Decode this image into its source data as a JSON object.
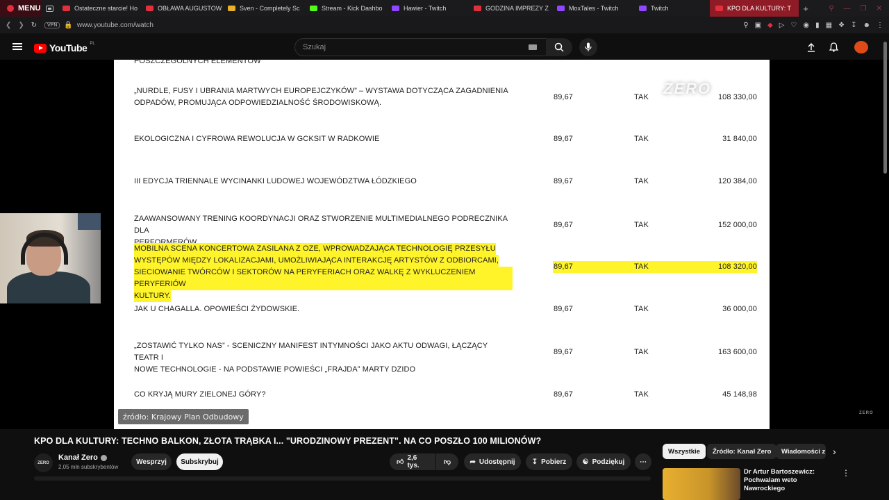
{
  "browser": {
    "menu_label": "MENU",
    "tabs": [
      {
        "label": "Ostateczne starcie! Ho",
        "icon": "youtube-icon",
        "color": "#e1303c"
      },
      {
        "label": "OBŁAWA AUGUSTOWS",
        "icon": "youtube-icon",
        "color": "#e1303c"
      },
      {
        "label": "Sven - Completely Sc",
        "icon": "crown-icon",
        "color": "#e8b12a"
      },
      {
        "label": "Stream - Kick Dashbo",
        "icon": "kick-icon",
        "color": "#53fc18"
      },
      {
        "label": "Hawier - Twitch",
        "icon": "twitch-icon",
        "color": "#9147ff"
      },
      {
        "label": "GODZINA IMPREZY Z ",
        "icon": "youtube-icon",
        "color": "#e1303c"
      },
      {
        "label": "MoxTales - Twitch",
        "icon": "twitch-muted-icon",
        "color": "#9147ff"
      },
      {
        "label": "Twitch",
        "icon": "twitch-icon",
        "color": "#9147ff"
      },
      {
        "label": "KPO DLA KULTURY: T",
        "icon": "youtube-icon",
        "color": "#e1303c",
        "active": true
      }
    ],
    "vpn_label": "VPN",
    "url": "www.youtube.com/watch"
  },
  "youtube": {
    "logo_text": "YouTube",
    "region": "PL",
    "search_placeholder": "Szukaj"
  },
  "document": {
    "top_fragment": "POSZCZEGÓLNYCH ELEMENTÓW",
    "rows": [
      {
        "title_lines": [
          "„NURDLE, FUSY I UBRANIA MARTWYCH EUROPEJCZYKÓW” – WYSTAWA DOTYCZĄCA ZAGADNIENIA",
          "ODPADÓW, PROMUJĄCA ODPOWIEDZIALNOŚĆ ŚRODOWISKOWĄ."
        ],
        "score": "89,67",
        "ok": "TAK",
        "amount": "108 330,00"
      },
      {
        "title_lines": [
          "EKOLOGICZNA I CYFROWA REWOLUCJA W GCKSIT W RADKOWIE"
        ],
        "score": "89,67",
        "ok": "TAK",
        "amount": "31 840,00"
      },
      {
        "title_lines": [
          "III EDYCJA TRIENNALE WYCINANKI LUDOWEJ WOJEWÓDZTWA ŁÓDZKIEGO"
        ],
        "score": "89,67",
        "ok": "TAK",
        "amount": "120 384,00"
      },
      {
        "title_lines": [
          "ZAAWANSOWANY TRENING KOORDYNACJI ORAZ  STWORZENIE MULTIMEDIALNEGO PODRECZNIKA DLA",
          "PERFORMERÓW"
        ],
        "score": "89,67",
        "ok": "TAK",
        "amount": "152 000,00"
      },
      {
        "title_lines": [
          "MOBILNA SCENA KONCERTOWA ZASILANA Z OZE, WPROWADZAJĄCA TECHNOLOGIĘ PRZESYŁU",
          "WYSTĘPÓW MIĘDZY LOKALIZACJAMI, UMOŻLIWIAJĄCA INTERAKCJĘ ARTYSTÓW Z ODBIORCAMI,",
          "SIECIOWANIE TWÓRCÓW I SEKTORÓW NA PERYFERIACH ORAZ WALKĘ Z WYKLUCZENIEM PERYFERIÓW",
          "KULTURY."
        ],
        "score": "89,67",
        "ok": "TAK",
        "amount": "108 320,00",
        "highlighted": true
      },
      {
        "title_lines": [
          "JAK U CHAGALLA. OPOWIEŚCI ŻYDOWSKIE."
        ],
        "score": "89,67",
        "ok": "TAK",
        "amount": "36 000,00"
      },
      {
        "title_lines": [
          "„ZOSTAWIĆ TYLKO NAS” - SCENICZNY MANIFEST INTYMNOŚCI JAKO AKTU ODWAGI, ŁĄCZĄCY TEATR I",
          "NOWE TECHNOLOGIE - NA PODSTAWIE POWIEŚCI „FRAJDA” MARTY DZIDO"
        ],
        "score": "89,67",
        "ok": "TAK",
        "amount": "163 600,00"
      },
      {
        "title_lines": [
          "CO KRYJĄ MURY ZIELONEJ GÓRY?"
        ],
        "score": "89,67",
        "ok": "TAK",
        "amount": "45 148,98"
      }
    ],
    "highlight_color": "#fff42a"
  },
  "overlay": {
    "watermark": "ZERO",
    "watermark_small": "ZERO",
    "source_label": "źródło: Krajowy Plan Odbudowy"
  },
  "video_info": {
    "title": "KPO DLA KULTURY: TECHNO BALKON, ZŁOTA TRĄBKA I... \"URODZINOWY PREZENT\". NA CO POSZŁO 100 MILIONÓW?",
    "channel_avatar_text": "ZERO",
    "channel_name": "Kanał Zero",
    "subscribers": "2,05 mln subskrybentów",
    "support_label": "Wesprzyj",
    "subscribe_label": "Subskrybuj",
    "likes": "2,6 tys.",
    "share_label": "Udostępnij",
    "download_label": "Pobierz",
    "thanks_label": "Podziękuj"
  },
  "sidebar": {
    "chips": [
      "Wszystkie",
      "Źródło: Kanał Zero",
      "Wiadomości z"
    ],
    "recommendation_title": "Dr Artur Bartoszewicz: Pochwalam weto Nawrockiego"
  }
}
